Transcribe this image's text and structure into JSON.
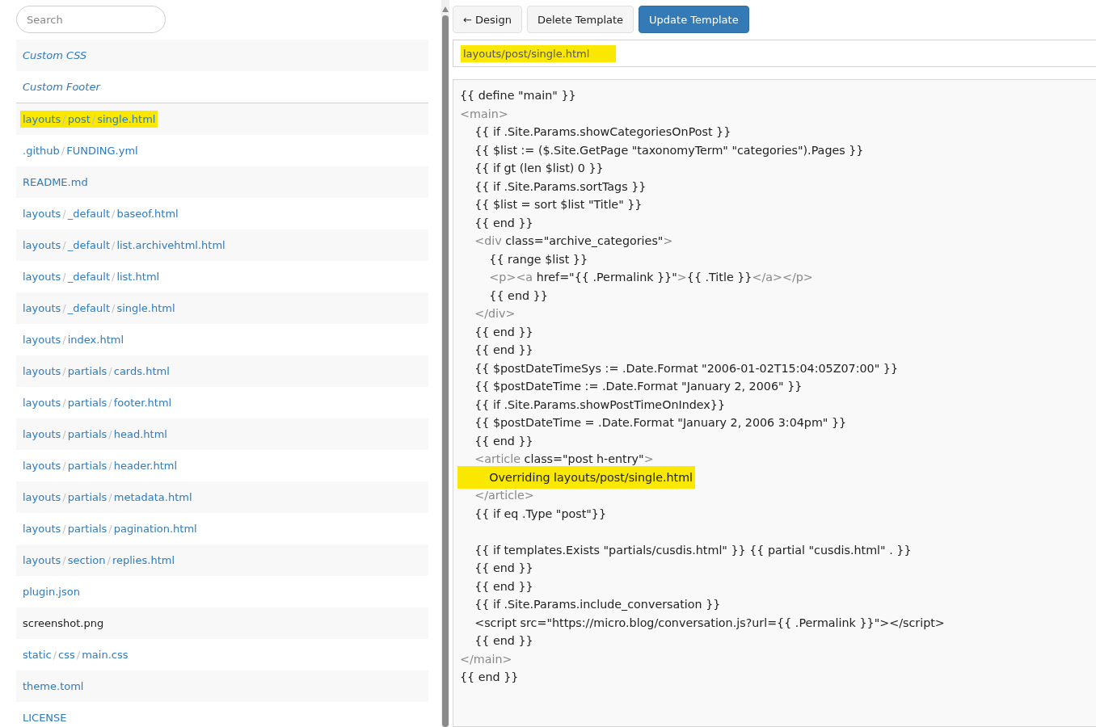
{
  "search": {
    "placeholder": "Search"
  },
  "file_list": {
    "separator": "/",
    "special_items": [
      {
        "label": "Custom CSS",
        "highlighted": false
      },
      {
        "label": "Custom Footer",
        "highlighted": false
      }
    ],
    "files": [
      {
        "parts": [
          "layouts",
          "post",
          "single.html"
        ],
        "kind": "template",
        "highlighted": true
      },
      {
        "parts": [
          ".github",
          "FUNDING.yml"
        ],
        "kind": "template",
        "highlighted": false
      },
      {
        "parts": [
          "README.md"
        ],
        "kind": "template",
        "highlighted": false
      },
      {
        "parts": [
          "layouts",
          "_default",
          "baseof.html"
        ],
        "kind": "template",
        "highlighted": false
      },
      {
        "parts": [
          "layouts",
          "_default",
          "list.archivehtml.html"
        ],
        "kind": "template",
        "highlighted": false
      },
      {
        "parts": [
          "layouts",
          "_default",
          "list.html"
        ],
        "kind": "template",
        "highlighted": false
      },
      {
        "parts": [
          "layouts",
          "_default",
          "single.html"
        ],
        "kind": "template",
        "highlighted": false
      },
      {
        "parts": [
          "layouts",
          "index.html"
        ],
        "kind": "template",
        "highlighted": false
      },
      {
        "parts": [
          "layouts",
          "partials",
          "cards.html"
        ],
        "kind": "template",
        "highlighted": false
      },
      {
        "parts": [
          "layouts",
          "partials",
          "footer.html"
        ],
        "kind": "template",
        "highlighted": false
      },
      {
        "parts": [
          "layouts",
          "partials",
          "head.html"
        ],
        "kind": "template",
        "highlighted": false
      },
      {
        "parts": [
          "layouts",
          "partials",
          "header.html"
        ],
        "kind": "template",
        "highlighted": false
      },
      {
        "parts": [
          "layouts",
          "partials",
          "metadata.html"
        ],
        "kind": "template",
        "highlighted": false
      },
      {
        "parts": [
          "layouts",
          "partials",
          "pagination.html"
        ],
        "kind": "template",
        "highlighted": false
      },
      {
        "parts": [
          "layouts",
          "section",
          "replies.html"
        ],
        "kind": "template",
        "highlighted": false
      },
      {
        "parts": [
          "plugin.json"
        ],
        "kind": "template",
        "highlighted": false
      },
      {
        "parts": [
          "screenshot.png"
        ],
        "kind": "binary",
        "highlighted": false
      },
      {
        "parts": [
          "static",
          "css",
          "main.css"
        ],
        "kind": "template",
        "highlighted": false
      },
      {
        "parts": [
          "theme.toml"
        ],
        "kind": "template",
        "highlighted": false
      },
      {
        "parts": [
          "LICENSE"
        ],
        "kind": "template",
        "highlighted": false
      }
    ]
  },
  "toolbar": {
    "buttons": [
      {
        "label": "← Design",
        "kind": "default"
      },
      {
        "label": "Delete Template",
        "kind": "default"
      },
      {
        "label": "Update Template",
        "kind": "primary"
      }
    ]
  },
  "path_field": {
    "value": "layouts/post/single.html",
    "highlighted": true
  },
  "code_lines": [
    {
      "kind": "code",
      "highlighted": false,
      "segments": [
        {
          "kind": "text",
          "text": "{{ define \"main\" }}"
        }
      ]
    },
    {
      "kind": "code",
      "highlighted": false,
      "segments": [
        {
          "kind": "tag",
          "text": "<main>"
        }
      ]
    },
    {
      "kind": "code",
      "highlighted": false,
      "segments": [
        {
          "kind": "text",
          "text": "    {{ if .Site.Params.showCategoriesOnPost }}"
        }
      ]
    },
    {
      "kind": "code",
      "highlighted": false,
      "segments": [
        {
          "kind": "text",
          "text": "    {{ $list := ($.Site.GetPage \"taxonomyTerm\" \"categories\").Pages }}"
        }
      ]
    },
    {
      "kind": "code",
      "highlighted": false,
      "segments": [
        {
          "kind": "text",
          "text": "    {{ if gt (len $list) 0 }}"
        }
      ]
    },
    {
      "kind": "code",
      "highlighted": false,
      "segments": [
        {
          "kind": "text",
          "text": "    {{ if .Site.Params.sortTags }}"
        }
      ]
    },
    {
      "kind": "code",
      "highlighted": false,
      "segments": [
        {
          "kind": "text",
          "text": "    {{ $list = sort $list \"Title\" }}"
        }
      ]
    },
    {
      "kind": "code",
      "highlighted": false,
      "segments": [
        {
          "kind": "text",
          "text": "    {{ end }}"
        }
      ]
    },
    {
      "kind": "code",
      "highlighted": false,
      "segments": [
        {
          "kind": "tag",
          "text": "    <div"
        },
        {
          "kind": "text",
          "text": " class=\"archive_categories\""
        },
        {
          "kind": "tag",
          "text": ">"
        }
      ]
    },
    {
      "kind": "code",
      "highlighted": false,
      "segments": [
        {
          "kind": "text",
          "text": "        {{ range $list }}"
        }
      ]
    },
    {
      "kind": "code",
      "highlighted": false,
      "segments": [
        {
          "kind": "tag",
          "text": "        <p><a"
        },
        {
          "kind": "text",
          "text": " href=\"{{ .Permalink }}\""
        },
        {
          "kind": "tag",
          "text": ">"
        },
        {
          "kind": "text",
          "text": "{{ .Title }}"
        },
        {
          "kind": "tag",
          "text": "</a></p>"
        }
      ]
    },
    {
      "kind": "code",
      "highlighted": false,
      "segments": [
        {
          "kind": "text",
          "text": "        {{ end }}"
        }
      ]
    },
    {
      "kind": "code",
      "highlighted": false,
      "segments": [
        {
          "kind": "tag",
          "text": "    </div>"
        }
      ]
    },
    {
      "kind": "code",
      "highlighted": false,
      "segments": [
        {
          "kind": "text",
          "text": "    {{ end }}"
        }
      ]
    },
    {
      "kind": "code",
      "highlighted": false,
      "segments": [
        {
          "kind": "text",
          "text": "    {{ end }}"
        }
      ]
    },
    {
      "kind": "code",
      "highlighted": false,
      "segments": [
        {
          "kind": "text",
          "text": "    {{ $postDateTimeSys := .Date.Format \"2006-01-02T15:04:05Z07:00\" }}"
        }
      ]
    },
    {
      "kind": "code",
      "highlighted": false,
      "segments": [
        {
          "kind": "text",
          "text": "    {{ $postDateTime := .Date.Format \"January 2, 2006\" }}"
        }
      ]
    },
    {
      "kind": "code",
      "highlighted": false,
      "segments": [
        {
          "kind": "text",
          "text": "    {{ if .Site.Params.showPostTimeOnIndex}}"
        }
      ]
    },
    {
      "kind": "code",
      "highlighted": false,
      "segments": [
        {
          "kind": "text",
          "text": "    {{ $postDateTime = .Date.Format \"January 2, 2006 3:04pm\" }}"
        }
      ]
    },
    {
      "kind": "code",
      "highlighted": false,
      "segments": [
        {
          "kind": "text",
          "text": "    {{ end }}"
        }
      ]
    },
    {
      "kind": "code",
      "highlighted": false,
      "segments": [
        {
          "kind": "tag",
          "text": "    <article"
        },
        {
          "kind": "text",
          "text": " class=\"post h-entry\""
        },
        {
          "kind": "tag",
          "text": ">"
        }
      ]
    },
    {
      "kind": "code",
      "highlighted": true,
      "segments": [
        {
          "kind": "text",
          "text": "        Overriding layouts/post/single.html"
        }
      ]
    },
    {
      "kind": "code",
      "highlighted": false,
      "segments": [
        {
          "kind": "tag",
          "text": "    </article>"
        }
      ]
    },
    {
      "kind": "code",
      "highlighted": false,
      "segments": [
        {
          "kind": "text",
          "text": "    {{ if eq .Type \"post\"}}"
        }
      ]
    },
    {
      "kind": "blank"
    },
    {
      "kind": "code",
      "highlighted": false,
      "segments": [
        {
          "kind": "text",
          "text": "    {{ if templates.Exists \"partials/cusdis.html\" }} {{ partial \"cusdis.html\" . }}"
        }
      ]
    },
    {
      "kind": "code",
      "highlighted": false,
      "segments": [
        {
          "kind": "text",
          "text": "    {{ end }}"
        }
      ]
    },
    {
      "kind": "code",
      "highlighted": false,
      "segments": [
        {
          "kind": "text",
          "text": "    {{ end }}"
        }
      ]
    },
    {
      "kind": "code",
      "highlighted": false,
      "segments": [
        {
          "kind": "text",
          "text": "    {{ if .Site.Params.include_conversation }}"
        }
      ]
    },
    {
      "kind": "code",
      "highlighted": false,
      "segments": [
        {
          "kind": "text",
          "text": "    <script src=\"https://micro.blog/conversation.js?url={{ .Permalink }}\"></script>"
        }
      ]
    },
    {
      "kind": "code",
      "highlighted": false,
      "segments": [
        {
          "kind": "text",
          "text": "    {{ end }}"
        }
      ]
    },
    {
      "kind": "code",
      "highlighted": false,
      "segments": [
        {
          "kind": "tag",
          "text": "</main>"
        }
      ]
    },
    {
      "kind": "code",
      "highlighted": false,
      "segments": [
        {
          "kind": "text",
          "text": "{{ end }}"
        }
      ]
    }
  ]
}
